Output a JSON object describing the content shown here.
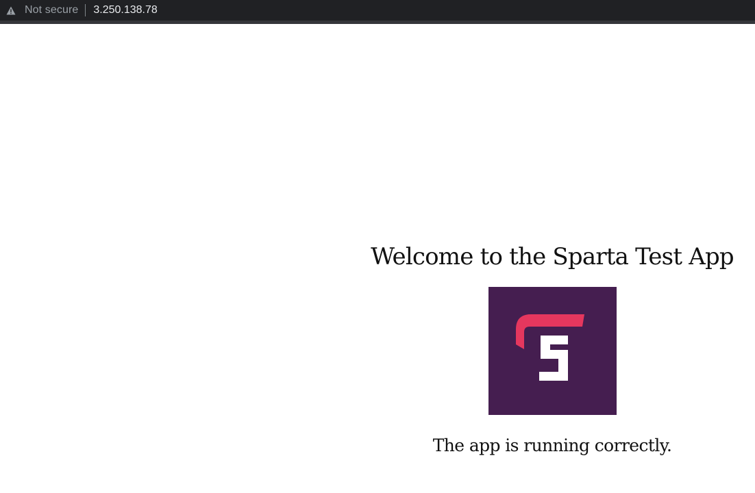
{
  "browser": {
    "security_label": "Not secure",
    "url": "3.250.138.78",
    "warning_icon": "warning-triangle-icon"
  },
  "main": {
    "title": "Welcome to the Sparta Test App",
    "status": "The app is running correctly.",
    "logo": {
      "name": "sparta-logo",
      "background_color": "#451e50",
      "accent_color": "#e5375e",
      "letter_color": "#ffffff"
    }
  }
}
